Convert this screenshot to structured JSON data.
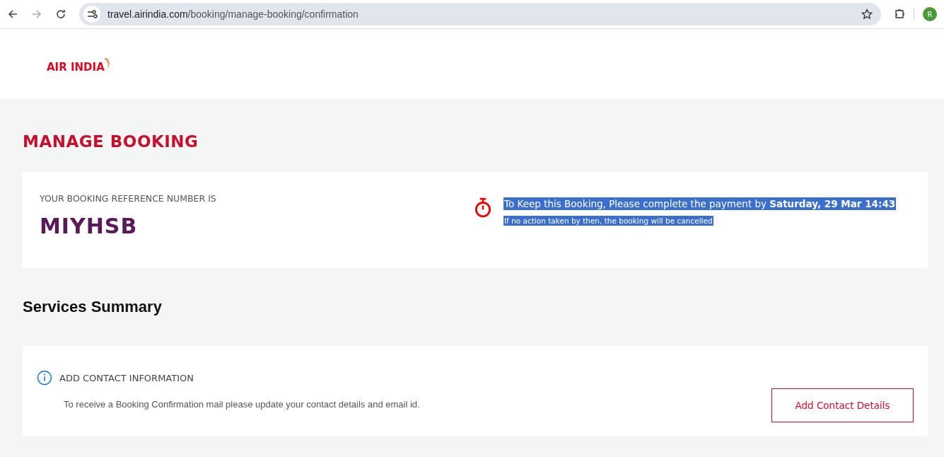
{
  "browser": {
    "url_host": "travel.airindia.com",
    "url_path": "/booking/manage-booking/confirmation",
    "profile_initial": "R"
  },
  "header": {
    "logo_text": "AIR INDIA"
  },
  "page_title": "MANAGE BOOKING",
  "booking": {
    "reference_label": "YOUR BOOKING REFERENCE NUMBER IS",
    "reference": "MIYHSB",
    "notice": {
      "highlighted": true,
      "message": "To Keep this Booking, Please complete the payment by **Saturday, 29 Mar 14:43**",
      "note": "If no action taken by then, the booking will be cancelled"
    }
  },
  "services_title": "Services Summary",
  "contact": {
    "title": "ADD CONTACT INFORMATION",
    "description": "To receive a Booking Confirmation mail please update your contact details and email id.",
    "button": "Add Contact Details"
  }
}
